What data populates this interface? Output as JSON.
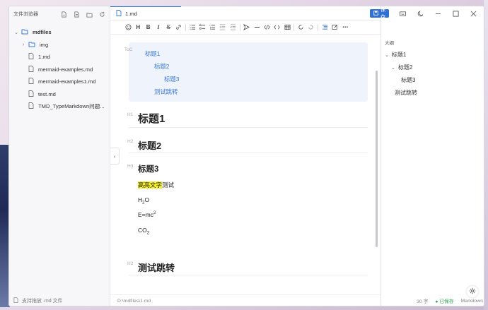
{
  "sidebar": {
    "title": "文件浏览器",
    "tree": [
      {
        "label": "mdfiles",
        "type": "folder",
        "expanded": true,
        "level": 0
      },
      {
        "label": "img",
        "type": "folder",
        "expanded": false,
        "level": 1
      },
      {
        "label": "1.md",
        "type": "file",
        "level": 1
      },
      {
        "label": "mermaid-examples.md",
        "type": "file",
        "level": 1
      },
      {
        "label": "mermaid-examples1.md",
        "type": "file",
        "level": 1
      },
      {
        "label": "test.md",
        "type": "file",
        "level": 1
      },
      {
        "label": "TMD_TypeMarkdown问题...",
        "type": "file",
        "level": 1
      }
    ],
    "footer": "支持拖放 .md 文件"
  },
  "tab": {
    "label": "1.md"
  },
  "toolbar": {
    "buttons": [
      "emoji",
      "H",
      "B",
      "I",
      "S",
      "link",
      "ul",
      "task",
      "ol",
      "indent",
      "outdent",
      "send",
      "hr",
      "code",
      "codeblock",
      "table",
      "undo",
      "redo",
      "toc",
      "edit",
      "more"
    ]
  },
  "editor": {
    "toc_label": "ToC",
    "toc": [
      "标题1",
      "标题2",
      "标题3",
      "测试跳转"
    ],
    "h1_label": "H1",
    "h1": "标题1",
    "h2_label": "H2",
    "h2": "标题2",
    "h3_label": "H3",
    "h3": "标题3",
    "highlight": "高亮文字",
    "highlight_tail": "测试",
    "water_h": "H",
    "water_sub": "2",
    "water_o": "O",
    "emc_base": "E=mc",
    "emc_sup": "2",
    "co_base": "CO",
    "co_sub": "2",
    "h2b_label": "H2",
    "h2b": "测试跳转"
  },
  "status": {
    "path": "D:\\mdfiles\\1.md",
    "word_count": "30 字",
    "saved": "● 已保存",
    "mode": "Markdown"
  },
  "right": {
    "save_label": "保存",
    "outline_title": "大纲",
    "outline": [
      "标题1",
      "标题2",
      "标题3",
      "测试跳转"
    ]
  },
  "colors": {
    "accent": "#2f6fd6",
    "highlight": "#f5f02a",
    "saved": "#2ea44f"
  }
}
